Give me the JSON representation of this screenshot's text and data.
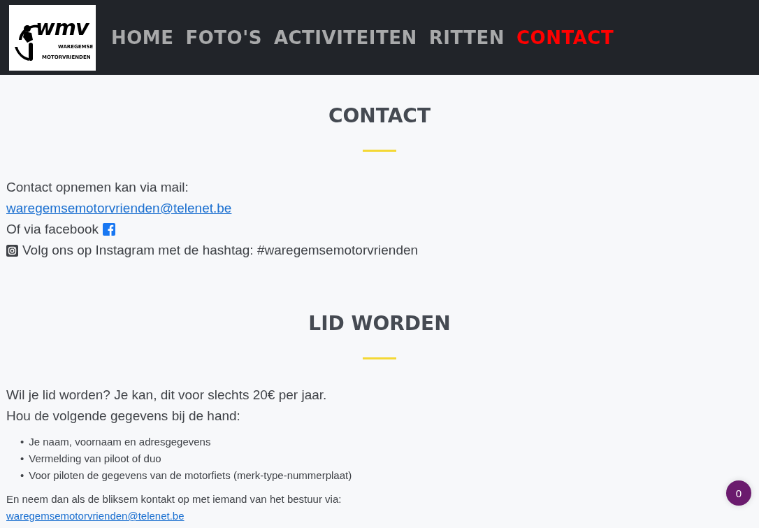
{
  "header": {
    "logo": {
      "mark": "wmv",
      "line_1": "WAREGEMSE",
      "line_2": "MOTORVRIENDEN"
    },
    "nav": [
      {
        "label": "HOME",
        "selected": false
      },
      {
        "label": "FOTO'S",
        "selected": false
      },
      {
        "label": "ACTIVITEITEN",
        "selected": false
      },
      {
        "label": "RITTEN",
        "selected": false
      },
      {
        "label": "CONTACT",
        "selected": true
      }
    ]
  },
  "contact": {
    "title": "CONTACT",
    "mail_intro": "Contact opnemen kan via mail:",
    "mail_link": "waregemsemotorvrienden@telenet.be",
    "facebook_text": "Of via facebook",
    "instagram_text": "Volg ons op Instagram met de hashtag: #waregemsemotorvrienden"
  },
  "membership": {
    "title": "LID WORDEN",
    "intro_lines": [
      "Wil je lid worden? Je kan, dit voor slechts 20€ per jaar.",
      "Hou de volgende gegevens bij de hand:"
    ],
    "bullet": "•",
    "requirements": [
      "Je naam, voornaam en adresgegevens",
      "Vermelding van piloot of duo",
      "Voor piloten de gegevens van de motorfiets (merk-type-nummerplaat)"
    ],
    "closing": "En neem dan als de bliksem kontakt op met iemand van het bestuur via:",
    "closing_link": "waregemsemotorvrienden@telenet.be"
  },
  "badge": {
    "count": "0"
  }
}
